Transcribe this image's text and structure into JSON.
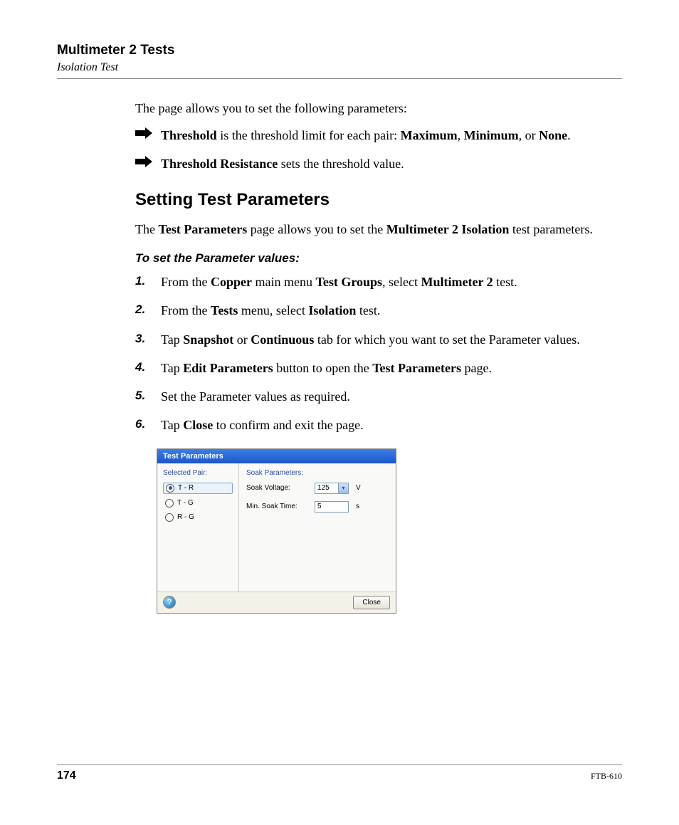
{
  "header": {
    "title": "Multimeter 2 Tests",
    "subtitle": "Isolation Test"
  },
  "intro": {
    "lead": "The page allows you to set the following parameters:",
    "bullets": [
      {
        "pre": "",
        "b1": "Threshold",
        "mid1": " is the threshold limit for each pair: ",
        "b2": "Maximum",
        "mid2": ", ",
        "b3": "Minimum",
        "mid3": ", or ",
        "b4": "None",
        "tail": "."
      },
      {
        "pre": "",
        "b1": "Threshold Resistance",
        "mid1": " sets the threshold value.",
        "b2": "",
        "mid2": "",
        "b3": "",
        "mid3": "",
        "b4": "",
        "tail": ""
      }
    ]
  },
  "section": {
    "heading": "Setting Test Parameters",
    "para_pre": "The ",
    "para_b1": "Test Parameters",
    "para_mid1": " page allows you to set the ",
    "para_b2": "Multimeter 2 Isolation",
    "para_tail": " test parameters.",
    "subheading": "To set the Parameter values:",
    "steps": [
      {
        "pre": "From the ",
        "b1": "Copper",
        "mid1": " main menu ",
        "b2": "Test Groups",
        "mid2": ", select ",
        "b3": "Multimeter 2",
        "mid3": " test",
        "b4": "",
        "tail": "."
      },
      {
        "pre": "From the ",
        "b1": "Tests",
        "mid1": " menu, select ",
        "b2": "Isolation",
        "mid2": " test.",
        "b3": "",
        "mid3": "",
        "b4": "",
        "tail": ""
      },
      {
        "pre": "Tap ",
        "b1": "Snapshot",
        "mid1": " or ",
        "b2": "Continuous",
        "mid2": " tab for which you want to set the Parameter values.",
        "b3": "",
        "mid3": "",
        "b4": "",
        "tail": ""
      },
      {
        "pre": "Tap ",
        "b1": "Edit Parameters",
        "mid1": " button to open the ",
        "b2": "Test Parameters",
        "mid2": " page.",
        "b3": "",
        "mid3": "",
        "b4": "",
        "tail": ""
      },
      {
        "pre": "Set the Parameter values as required.",
        "b1": "",
        "mid1": "",
        "b2": "",
        "mid2": "",
        "b3": "",
        "mid3": "",
        "b4": "",
        "tail": ""
      },
      {
        "pre": "Tap ",
        "b1": "Close",
        "mid1": " to confirm and exit the page.",
        "b2": "",
        "mid2": "",
        "b3": "",
        "mid3": "",
        "b4": "",
        "tail": ""
      }
    ]
  },
  "dialog": {
    "title": "Test Parameters",
    "left_label": "Selected Pair:",
    "pairs": [
      {
        "label": "T - R",
        "checked": true
      },
      {
        "label": "T - G",
        "checked": false
      },
      {
        "label": "R - G",
        "checked": false
      }
    ],
    "right_label": "Soak Parameters:",
    "soak_voltage_label": "Soak Voltage:",
    "soak_voltage_value": "125",
    "soak_voltage_unit": "V",
    "min_soak_label": "Min. Soak Time:",
    "min_soak_value": "5",
    "min_soak_unit": "s",
    "help": "?",
    "close": "Close"
  },
  "footer": {
    "page": "174",
    "doc": "FTB-610"
  }
}
